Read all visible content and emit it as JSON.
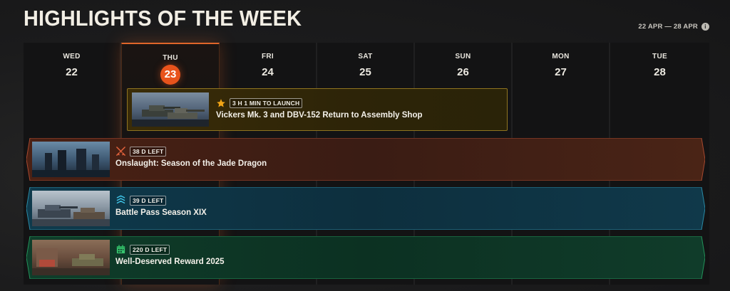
{
  "header": {
    "title": "HIGHLIGHTS OF THE WEEK",
    "date_range": "22 APR — 28 APR",
    "info_icon": "info-icon"
  },
  "days": [
    {
      "name": "WED",
      "num": "22"
    },
    {
      "name": "THU",
      "num": "23",
      "today": true
    },
    {
      "name": "FRI",
      "num": "24"
    },
    {
      "name": "SAT",
      "num": "25"
    },
    {
      "name": "SUN",
      "num": "26"
    },
    {
      "name": "MON",
      "num": "27"
    },
    {
      "name": "TUE",
      "num": "28"
    }
  ],
  "events": {
    "launch": {
      "badge": "3 H 1 MIN TO LAUNCH",
      "title": "Vickers Mk. 3 and DBV-152 Return to Assembly Shop",
      "icon": "star-icon",
      "accent": "#8f7420"
    },
    "onslaught": {
      "badge": "38 D LEFT",
      "title": "Onslaught: Season of the Jade Dragon",
      "icon": "crossed-swords-icon",
      "accent": "#c0583a"
    },
    "battle_pass": {
      "badge": "39 D LEFT",
      "title": "Battle Pass Season XIX",
      "icon": "battle-pass-icon",
      "accent": "#2f93b0"
    },
    "reward": {
      "badge": "220 D LEFT",
      "title": "Well-Deserved Reward 2025",
      "icon": "calendar-icon",
      "accent": "#2fae62"
    }
  }
}
